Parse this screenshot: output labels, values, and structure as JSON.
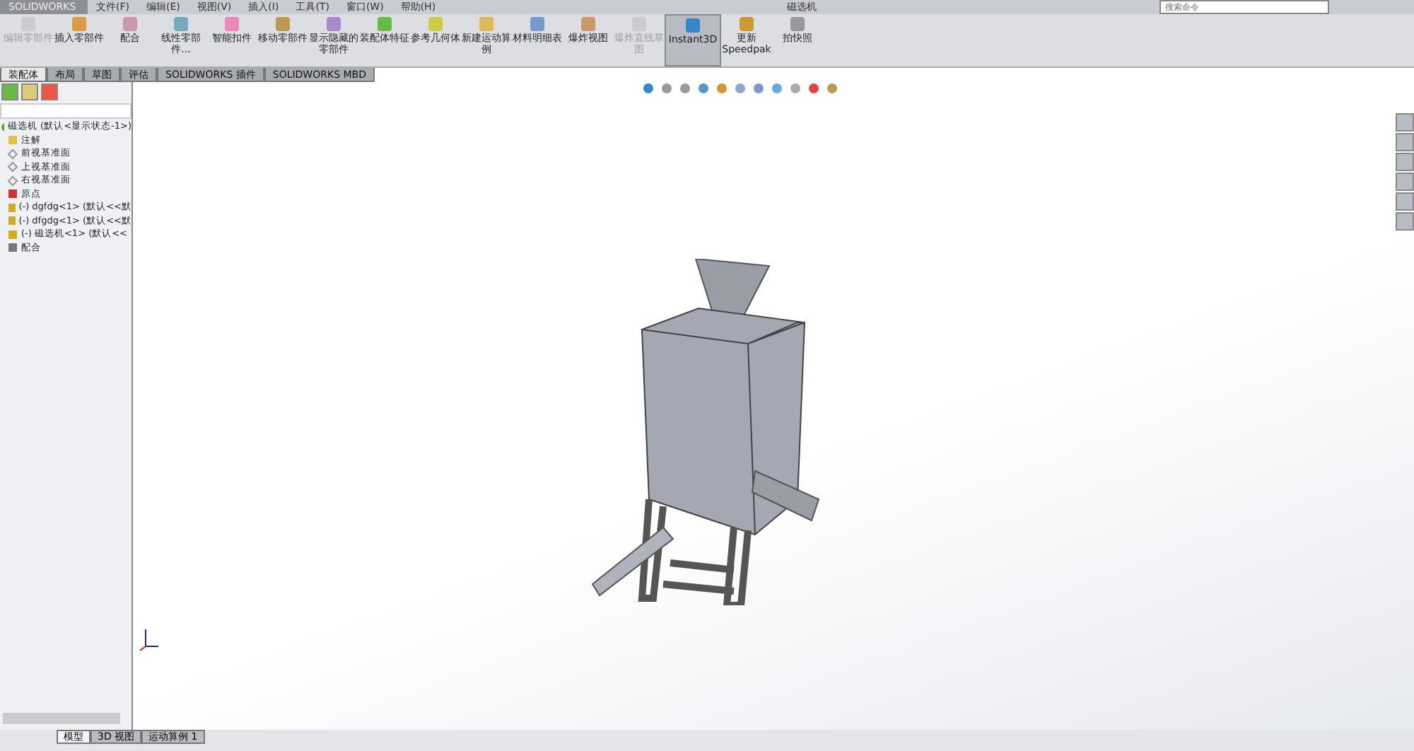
{
  "app": {
    "logo": "SOLIDWORKS",
    "title": "磁选机"
  },
  "menu": [
    "文件(F)",
    "编辑(E)",
    "视图(V)",
    "插入(I)",
    "工具(T)",
    "窗口(W)",
    "帮助(H)"
  ],
  "search": {
    "placeholder": "搜索命令"
  },
  "ribbon": [
    {
      "label": "编辑零部件",
      "disabled": true,
      "selected": false
    },
    {
      "label": "插入零部件",
      "disabled": false,
      "selected": false
    },
    {
      "label": "配合",
      "disabled": false,
      "selected": false
    },
    {
      "label": "线性零部件...",
      "disabled": false,
      "selected": false
    },
    {
      "label": "智能扣件",
      "disabled": false,
      "selected": false
    },
    {
      "label": "移动零部件",
      "disabled": false,
      "selected": false
    },
    {
      "label": "显示隐藏的零部件",
      "disabled": false,
      "selected": false
    },
    {
      "label": "装配体特征",
      "disabled": false,
      "selected": false
    },
    {
      "label": "参考几何体",
      "disabled": false,
      "selected": false
    },
    {
      "label": "新建运动算例",
      "disabled": false,
      "selected": false
    },
    {
      "label": "材料明细表",
      "disabled": false,
      "selected": false
    },
    {
      "label": "爆炸视图",
      "disabled": false,
      "selected": false
    },
    {
      "label": "爆炸直线草图",
      "disabled": true,
      "selected": false
    },
    {
      "label": "Instant3D",
      "disabled": false,
      "selected": true
    },
    {
      "label": "更新Speedpak",
      "disabled": false,
      "selected": false
    },
    {
      "label": "拍快照",
      "disabled": false,
      "selected": false
    }
  ],
  "tabs": [
    {
      "label": "装配体",
      "selected": true
    },
    {
      "label": "布局",
      "selected": false
    },
    {
      "label": "草图",
      "selected": false
    },
    {
      "label": "评估",
      "selected": false
    },
    {
      "label": "SOLIDWORKS 插件",
      "selected": false
    },
    {
      "label": "SOLIDWORKS MBD",
      "selected": false
    }
  ],
  "tree": {
    "label": "磁选机 (默认<显示状态-1>)",
    "children": [
      {
        "label": "注解",
        "kind": "annotation"
      },
      {
        "label": "前视基准面",
        "kind": "plane"
      },
      {
        "label": "上视基准面",
        "kind": "plane"
      },
      {
        "label": "右视基准面",
        "kind": "plane"
      },
      {
        "label": "原点",
        "kind": "origin"
      },
      {
        "label": "(-) dgfdg<1> (默认<<默",
        "kind": "part"
      },
      {
        "label": "(-) dfgdg<1> (默认<<默",
        "kind": "part"
      },
      {
        "label": "(-) 磁选机<1> (默认<<",
        "kind": "part"
      },
      {
        "label": "配合",
        "kind": "mates"
      }
    ]
  },
  "bottom_tabs": [
    {
      "label": "模型",
      "selected": true
    },
    {
      "label": "3D 视图",
      "selected": false
    },
    {
      "label": "运动算例 1",
      "selected": false
    }
  ]
}
